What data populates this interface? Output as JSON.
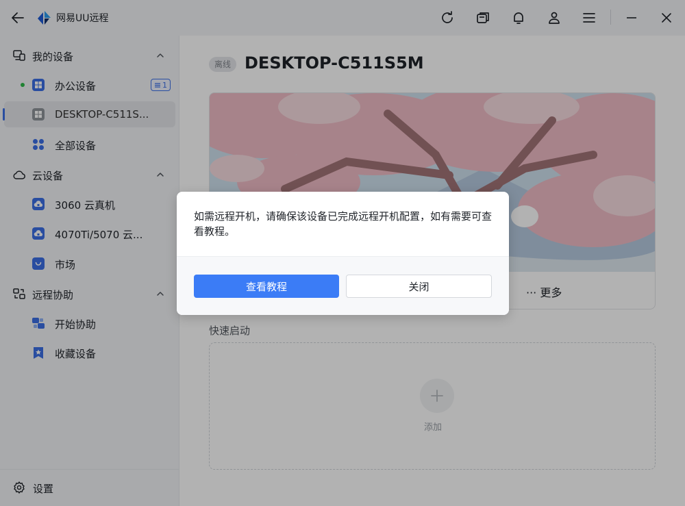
{
  "titlebar": {
    "app_title": "网易UU远程",
    "icons": [
      "back-arrow-icon",
      "app-logo",
      "refresh-icon",
      "window-icon",
      "bell-icon",
      "user-icon",
      "menu-icon",
      "minimize-icon",
      "close-icon"
    ]
  },
  "sidebar": {
    "my_devices": {
      "label": "我的设备",
      "items": [
        {
          "label": "办公设备",
          "online": true,
          "badge": "1"
        },
        {
          "label": "DESKTOP-C511S...",
          "active": true
        },
        {
          "label": "全部设备"
        }
      ]
    },
    "cloud_devices": {
      "label": "云设备",
      "items": [
        {
          "label": "3060 云真机"
        },
        {
          "label": "4070Ti/5070 云..."
        },
        {
          "label": "市场"
        }
      ]
    },
    "remote_assist": {
      "label": "远程协助",
      "items": [
        {
          "label": "开始协助"
        },
        {
          "label": "收藏设备"
        }
      ]
    },
    "settings_label": "设置"
  },
  "main": {
    "status": "离线",
    "device_name": "DESKTOP-C511S5M",
    "more_label": "更多",
    "quick_start_label": "快速启动",
    "add_label": "添加"
  },
  "dialog": {
    "message": "如需远程开机，请确保该设备已完成远程开机配置，如有需要可查看教程。",
    "primary_button": "查看教程",
    "secondary_button": "关闭"
  },
  "colors": {
    "accent": "#3b7cf6",
    "online": "#2fba4a"
  }
}
